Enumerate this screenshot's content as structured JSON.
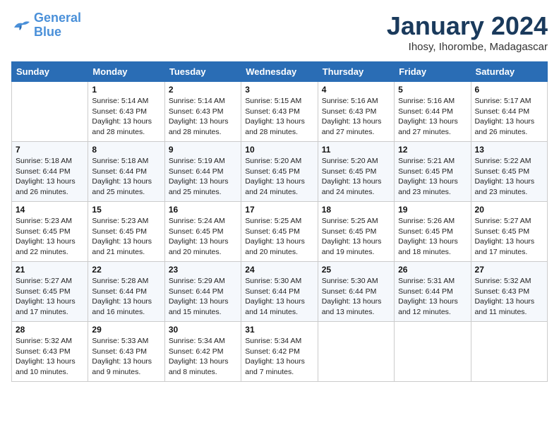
{
  "logo": {
    "line1": "General",
    "line2": "Blue"
  },
  "title": "January 2024",
  "location": "Ihosy, Ihorombe, Madagascar",
  "days_of_week": [
    "Sunday",
    "Monday",
    "Tuesday",
    "Wednesday",
    "Thursday",
    "Friday",
    "Saturday"
  ],
  "weeks": [
    [
      {
        "day": "",
        "info": ""
      },
      {
        "day": "1",
        "info": "Sunrise: 5:14 AM\nSunset: 6:43 PM\nDaylight: 13 hours\nand 28 minutes."
      },
      {
        "day": "2",
        "info": "Sunrise: 5:14 AM\nSunset: 6:43 PM\nDaylight: 13 hours\nand 28 minutes."
      },
      {
        "day": "3",
        "info": "Sunrise: 5:15 AM\nSunset: 6:43 PM\nDaylight: 13 hours\nand 28 minutes."
      },
      {
        "day": "4",
        "info": "Sunrise: 5:16 AM\nSunset: 6:43 PM\nDaylight: 13 hours\nand 27 minutes."
      },
      {
        "day": "5",
        "info": "Sunrise: 5:16 AM\nSunset: 6:44 PM\nDaylight: 13 hours\nand 27 minutes."
      },
      {
        "day": "6",
        "info": "Sunrise: 5:17 AM\nSunset: 6:44 PM\nDaylight: 13 hours\nand 26 minutes."
      }
    ],
    [
      {
        "day": "7",
        "info": "Sunrise: 5:18 AM\nSunset: 6:44 PM\nDaylight: 13 hours\nand 26 minutes."
      },
      {
        "day": "8",
        "info": "Sunrise: 5:18 AM\nSunset: 6:44 PM\nDaylight: 13 hours\nand 25 minutes."
      },
      {
        "day": "9",
        "info": "Sunrise: 5:19 AM\nSunset: 6:44 PM\nDaylight: 13 hours\nand 25 minutes."
      },
      {
        "day": "10",
        "info": "Sunrise: 5:20 AM\nSunset: 6:45 PM\nDaylight: 13 hours\nand 24 minutes."
      },
      {
        "day": "11",
        "info": "Sunrise: 5:20 AM\nSunset: 6:45 PM\nDaylight: 13 hours\nand 24 minutes."
      },
      {
        "day": "12",
        "info": "Sunrise: 5:21 AM\nSunset: 6:45 PM\nDaylight: 13 hours\nand 23 minutes."
      },
      {
        "day": "13",
        "info": "Sunrise: 5:22 AM\nSunset: 6:45 PM\nDaylight: 13 hours\nand 23 minutes."
      }
    ],
    [
      {
        "day": "14",
        "info": "Sunrise: 5:23 AM\nSunset: 6:45 PM\nDaylight: 13 hours\nand 22 minutes."
      },
      {
        "day": "15",
        "info": "Sunrise: 5:23 AM\nSunset: 6:45 PM\nDaylight: 13 hours\nand 21 minutes."
      },
      {
        "day": "16",
        "info": "Sunrise: 5:24 AM\nSunset: 6:45 PM\nDaylight: 13 hours\nand 20 minutes."
      },
      {
        "day": "17",
        "info": "Sunrise: 5:25 AM\nSunset: 6:45 PM\nDaylight: 13 hours\nand 20 minutes."
      },
      {
        "day": "18",
        "info": "Sunrise: 5:25 AM\nSunset: 6:45 PM\nDaylight: 13 hours\nand 19 minutes."
      },
      {
        "day": "19",
        "info": "Sunrise: 5:26 AM\nSunset: 6:45 PM\nDaylight: 13 hours\nand 18 minutes."
      },
      {
        "day": "20",
        "info": "Sunrise: 5:27 AM\nSunset: 6:45 PM\nDaylight: 13 hours\nand 17 minutes."
      }
    ],
    [
      {
        "day": "21",
        "info": "Sunrise: 5:27 AM\nSunset: 6:45 PM\nDaylight: 13 hours\nand 17 minutes."
      },
      {
        "day": "22",
        "info": "Sunrise: 5:28 AM\nSunset: 6:44 PM\nDaylight: 13 hours\nand 16 minutes."
      },
      {
        "day": "23",
        "info": "Sunrise: 5:29 AM\nSunset: 6:44 PM\nDaylight: 13 hours\nand 15 minutes."
      },
      {
        "day": "24",
        "info": "Sunrise: 5:30 AM\nSunset: 6:44 PM\nDaylight: 13 hours\nand 14 minutes."
      },
      {
        "day": "25",
        "info": "Sunrise: 5:30 AM\nSunset: 6:44 PM\nDaylight: 13 hours\nand 13 minutes."
      },
      {
        "day": "26",
        "info": "Sunrise: 5:31 AM\nSunset: 6:44 PM\nDaylight: 13 hours\nand 12 minutes."
      },
      {
        "day": "27",
        "info": "Sunrise: 5:32 AM\nSunset: 6:43 PM\nDaylight: 13 hours\nand 11 minutes."
      }
    ],
    [
      {
        "day": "28",
        "info": "Sunrise: 5:32 AM\nSunset: 6:43 PM\nDaylight: 13 hours\nand 10 minutes."
      },
      {
        "day": "29",
        "info": "Sunrise: 5:33 AM\nSunset: 6:43 PM\nDaylight: 13 hours\nand 9 minutes."
      },
      {
        "day": "30",
        "info": "Sunrise: 5:34 AM\nSunset: 6:42 PM\nDaylight: 13 hours\nand 8 minutes."
      },
      {
        "day": "31",
        "info": "Sunrise: 5:34 AM\nSunset: 6:42 PM\nDaylight: 13 hours\nand 7 minutes."
      },
      {
        "day": "",
        "info": ""
      },
      {
        "day": "",
        "info": ""
      },
      {
        "day": "",
        "info": ""
      }
    ]
  ]
}
